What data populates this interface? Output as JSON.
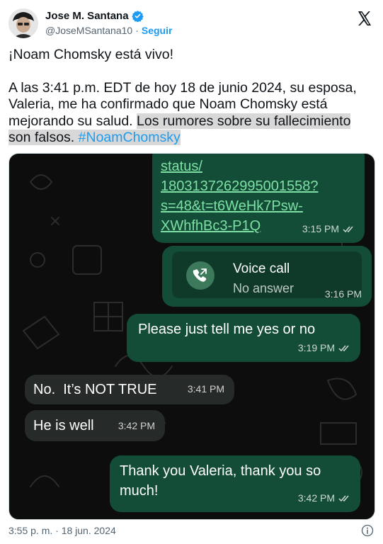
{
  "author": {
    "name": "Jose M. Santana",
    "handle": "@JoseMSantana10",
    "separator": "·",
    "follow_label": "Seguir"
  },
  "icons": {
    "verified": "verified-badge-icon",
    "platform": "x-logo-icon",
    "call": "phone-call-icon",
    "info": "info-icon",
    "read": "double-check-icon"
  },
  "colors": {
    "accent": "#1d9bf0",
    "outgoing_bubble": "#144d37",
    "incoming_bubble": "#262b2a",
    "chat_background": "#0c0d0c"
  },
  "tweet": {
    "line1": "¡Noam Chomsky está vivo!",
    "body_plain": "A las 3:41 p.m. EDT de hoy 18 de junio 2024, su esposa, Valeria, me ha confirmado que Noam Chomsky está mejorando su salud. ",
    "body_highlight": "Los rumores sobre su fallecimiento son falsos. ",
    "hashtag": "#NoamChomsky"
  },
  "chat": {
    "link": {
      "lines": [
        "status/",
        "1803137262995001558?",
        "s=48&t=t6WeHk7Psw-",
        "XWhfhBc3-P1Q"
      ],
      "time": "3:15 PM"
    },
    "call": {
      "title": "Voice call",
      "subtitle": "No answer",
      "time": "3:16 PM"
    },
    "messages": [
      {
        "text": "Please just tell me yes or no",
        "time": "3:19 PM"
      },
      {
        "text": "No.  It’s NOT TRUE",
        "time": "3:41 PM"
      },
      {
        "text": "He is well",
        "time": "3:42 PM"
      },
      {
        "text": "Thank you Valeria, thank you so much!",
        "time": "3:42 PM"
      }
    ]
  },
  "footer": {
    "timestamp": "3:55 p. m. · 18 jun. 2024"
  }
}
